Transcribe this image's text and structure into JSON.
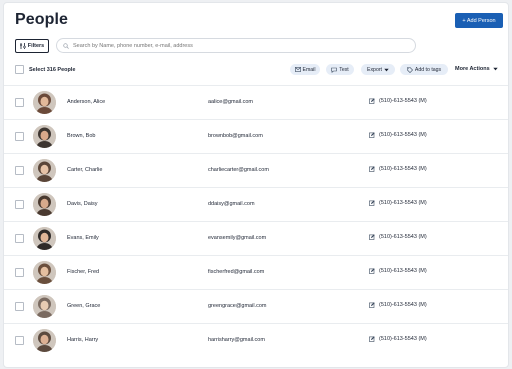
{
  "page": {
    "title": "People"
  },
  "header": {
    "add_person_label": "+ Add Person"
  },
  "filters": {
    "label": "Filters"
  },
  "search": {
    "placeholder": "Search by Name, phone number, e-mail, address"
  },
  "toolbar": {
    "select_all_label": "Select 316 People",
    "email_label": "Email",
    "text_label": "Text",
    "export_label": "Export",
    "add_tags_label": "Add to tags",
    "more_actions_label": "More Actions"
  },
  "people": [
    {
      "name": "Anderson, Alice",
      "email": "aalice@gmail.com",
      "phone": "(510)-613-5543 (M)"
    },
    {
      "name": "Brown, Bob",
      "email": "brownbob@gmail.com",
      "phone": "(510)-613-5543 (M)"
    },
    {
      "name": "Carter, Charlie",
      "email": "charliecarter@gmail.com",
      "phone": "(510)-613-5543 (M)"
    },
    {
      "name": "Davis, Daisy",
      "email": "ddaisy@gmail.com",
      "phone": "(510)-613-5543 (M)"
    },
    {
      "name": "Evans, Emily",
      "email": "evansemily@gmail.com",
      "phone": "(510)-613-5543 (M)"
    },
    {
      "name": "Fischer, Fred",
      "email": "fischerfred@gmail.com",
      "phone": "(510)-613-5543 (M)"
    },
    {
      "name": "Green, Grace",
      "email": "greengrace@gmail.com",
      "phone": "(510)-613-5543 (M)"
    },
    {
      "name": "Harris, Harry",
      "email": "harrisharry@gmail.com",
      "phone": "(510)-613-5543 (M)"
    }
  ],
  "colors": {
    "primary": "#1a5fb4",
    "pill_bg": "#e6edf7",
    "text": "#1d2433"
  }
}
